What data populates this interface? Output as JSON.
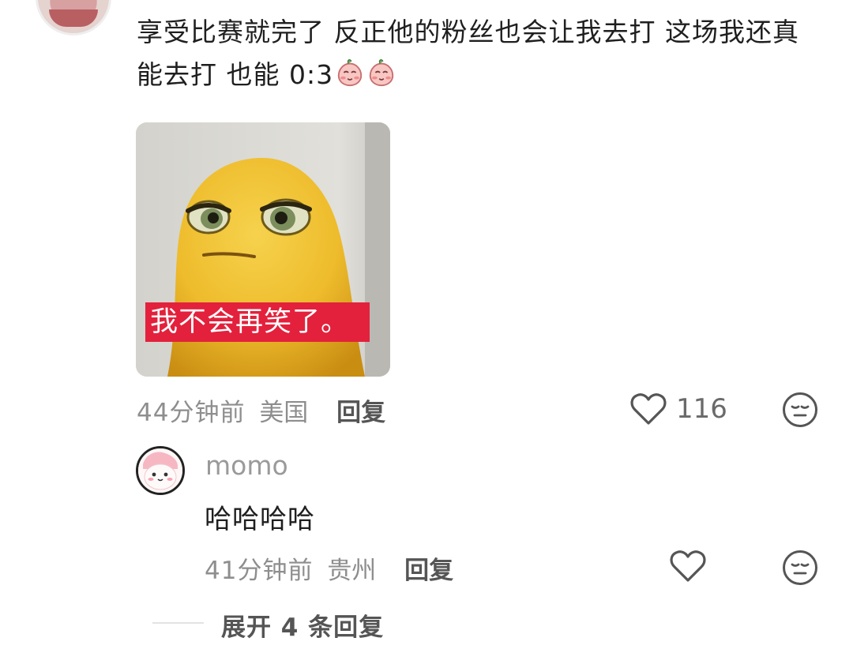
{
  "comment": {
    "text": "享受比赛就完了 反正他的粉丝也会让我去打 这场我还真能去打 也能 0:3",
    "emojis": [
      "shy-peach-emoji",
      "shy-peach-emoji"
    ],
    "image_caption": "我不会再笑了。",
    "time": "44分钟前",
    "location": "美国",
    "reply_label": "回复",
    "like_count": "116",
    "icons": {
      "like": "heart-outline-icon",
      "dislike": "meh-face-icon"
    }
  },
  "reply": {
    "username": "momo",
    "text": "哈哈哈哈",
    "time": "41分钟前",
    "location": "贵州",
    "reply_label": "回复"
  },
  "expand": {
    "label": "展开 4 条回复"
  },
  "colors": {
    "caption_bg": "#e3213c",
    "meme_character": "#efc233",
    "meta_text": "#8e8e8e"
  }
}
